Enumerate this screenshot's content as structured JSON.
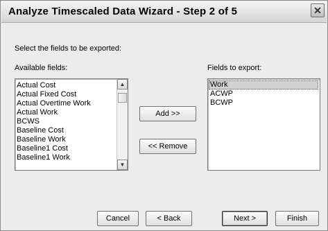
{
  "window": {
    "title": "Analyze Timescaled Data Wizard - Step 2 of 5",
    "close_glyph": "✕"
  },
  "instructions": "Select the fields to be exported:",
  "available": {
    "label": "Available fields:",
    "items": [
      "Actual Cost",
      "Actual Fixed Cost",
      "Actual Overtime Work",
      "Actual Work",
      "BCWS",
      "Baseline Cost",
      "Baseline Work",
      "Baseline1 Cost",
      "Baseline1 Work"
    ]
  },
  "export": {
    "label": "Fields to export:",
    "items": [
      "Work",
      "ACWP",
      "BCWP"
    ],
    "selected": "Work"
  },
  "buttons": {
    "add": "Add >>",
    "remove": "<< Remove",
    "cancel": "Cancel",
    "back": "< Back",
    "next": "Next >",
    "finish": "Finish"
  },
  "icons": {
    "scroll_up": "chevron-up-icon",
    "scroll_down": "chevron-down-icon",
    "close": "close-icon"
  }
}
